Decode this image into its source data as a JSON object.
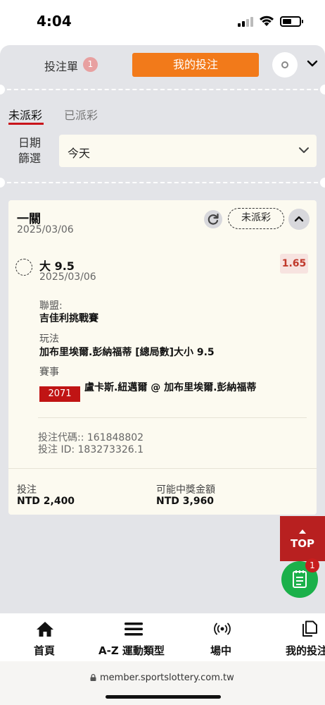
{
  "status_bar": {
    "time": "4:04"
  },
  "header": {
    "betslip_label": "投注單",
    "betslip_count": "1",
    "my_bets_label": "我的投注"
  },
  "tabs": {
    "unsettled": "未派彩",
    "settled": "已派彩"
  },
  "date_filter": {
    "label": "日期篩選",
    "value": "今天"
  },
  "bet": {
    "type": "一關",
    "date": "2025/03/06",
    "status": "未派彩",
    "selection": {
      "name": "大 9.5",
      "date": "2025/03/06",
      "odds": "1.65",
      "league_label": "聯盟:",
      "league_value": "吉佳利挑戰賽",
      "market_label": "玩法",
      "market_value": "加布里埃爾.彭納福蒂 [總局數]大小 9.5",
      "event_label": "賽事",
      "event_code": "2071",
      "event_name": "盧卡斯.紐邁爾 @ 加布里埃爾.彭納福蒂"
    },
    "bet_code": "投注代碼:: 161848802",
    "bet_id": "投注 ID: 183273326.1",
    "stake_label": "投注",
    "stake_value": "NTD 2,400",
    "payout_label": "可能中獎金額",
    "payout_value": "NTD 3,960"
  },
  "floating": {
    "top_label": "TOP",
    "slip_count": "1"
  },
  "bottom_nav": {
    "home": "首頁",
    "az_sports": "A-Z 運動類型",
    "live": "場中",
    "my_bets": "我的投注"
  },
  "browser": {
    "url": "member.sportslottery.com.tw"
  },
  "colors": {
    "accent_orange": "#f27a1a",
    "event_code_red": "#c01414",
    "odds_red": "#c0392b",
    "top_button_red": "#b82020",
    "fab_green": "#1bb04a"
  }
}
